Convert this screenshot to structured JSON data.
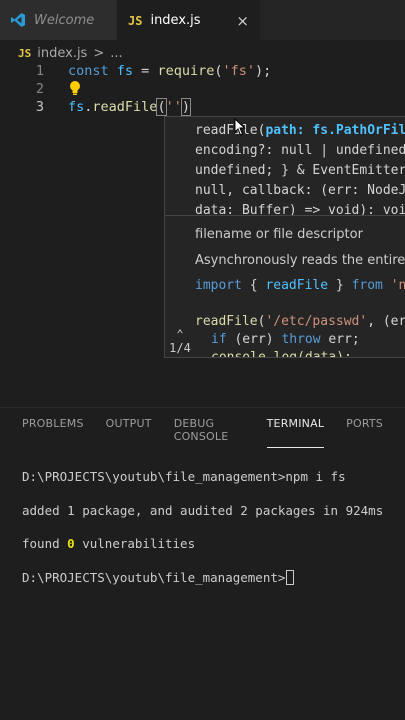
{
  "tabs": [
    {
      "label": "Welcome",
      "icon": "vscode-logo-icon",
      "active": false
    },
    {
      "label": "index.js",
      "icon": "javascript-file-icon",
      "badge": "JS",
      "active": true,
      "close": "×"
    }
  ],
  "breadcrumb": {
    "badge": "JS",
    "file": "index.js",
    "separator": ">",
    "more": "..."
  },
  "editor": {
    "lines": [
      {
        "number": "1",
        "tokens": [
          "const",
          "fs",
          " = ",
          "require",
          "(",
          "'fs'",
          ");"
        ]
      },
      {
        "number": "2"
      },
      {
        "number": "3",
        "tokens": [
          "fs",
          ".",
          "readFile",
          "(",
          "''",
          ")"
        ]
      }
    ]
  },
  "hover": {
    "signature": {
      "line1_fn": "readFile(",
      "line1_param": "path: fs.PathOrFileD",
      "line2": "encoding?: null | undefined;",
      "line3": "undefined; } & EventEmitter.A",
      "line4": "null, callback: (err: NodeJS.",
      "line5": "data: Buffer) => void): void"
    },
    "param_doc": "filename or file descriptor",
    "description": "Asynchronously reads the entire co",
    "example_import": {
      "kw": "import",
      "open": " { ",
      "name": "readFile",
      "close": " } ",
      "from": "from",
      "mod": " 'no"
    },
    "example_call": {
      "fn": "readFile",
      "open": "(",
      "str": "'/etc/passwd'",
      "rest": ", (err,"
    },
    "example_if": {
      "kw": "if",
      "cond": " (err) ",
      "throw": "throw",
      "rest": " err;"
    },
    "example_log": "console.log(data);",
    "counter": "1/4"
  },
  "panel": {
    "tabs": [
      "PROBLEMS",
      "OUTPUT",
      "DEBUG CONSOLE",
      "TERMINAL",
      "PORTS"
    ],
    "active_tab": "TERMINAL"
  },
  "terminal": {
    "cmd_line": "D:\\PROJECTS\\youtub\\file_management>npm i fs",
    "added": "added 1 package, and audited 2 packages in 924ms",
    "found_prefix": "found ",
    "found_count": "0",
    "found_suffix": " vulnerabilities",
    "prompt": "D:\\PROJECTS\\youtub\\file_management>"
  },
  "colors": {
    "keyword": "#569cd6",
    "variable": "#4fc1ff",
    "function": "#dcdcaa",
    "string": "#ce9178",
    "js_badge": "#e5c343"
  }
}
